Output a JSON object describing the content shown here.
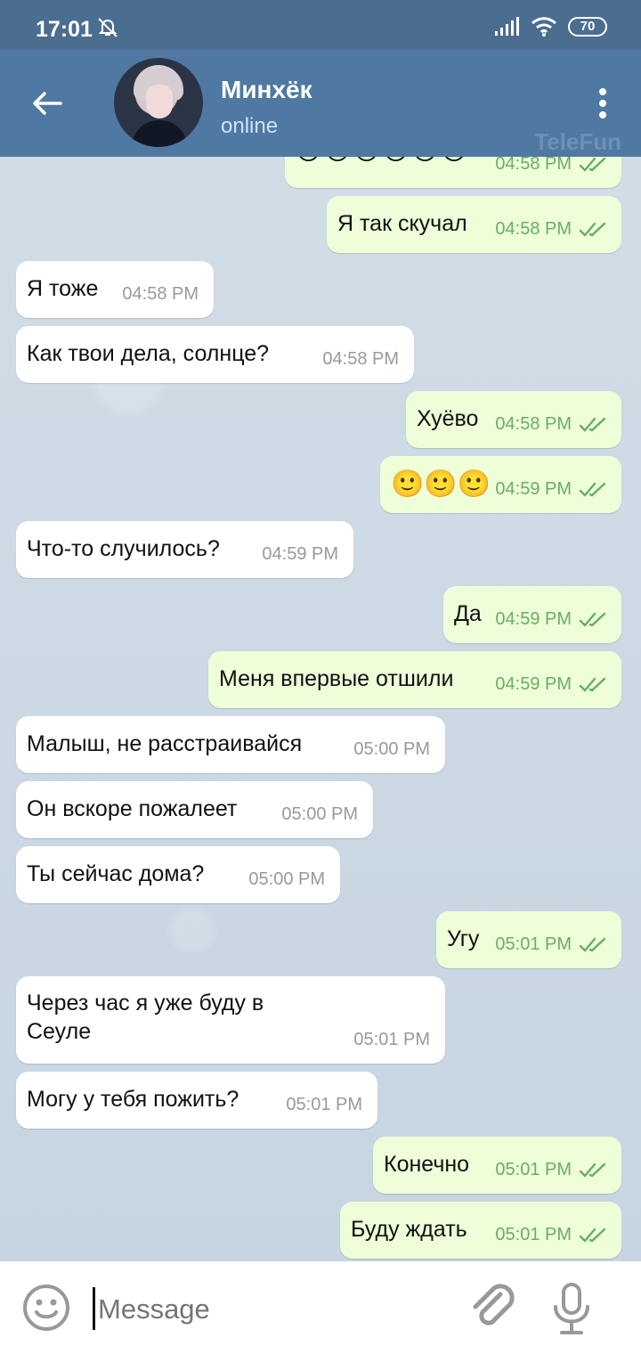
{
  "status_bar": {
    "time": "17:01",
    "battery": "70"
  },
  "header": {
    "name": "Минхёк",
    "status": "online",
    "watermark": "TeleFun"
  },
  "messages": [
    {
      "dir": "out",
      "text": "😭😭😭😭😭😭",
      "time": "04:58 PM"
    },
    {
      "dir": "out",
      "text": "Я так скучал",
      "time": "04:58 PM"
    },
    {
      "dir": "in",
      "text": "Я тоже",
      "time": "04:58 PM"
    },
    {
      "dir": "in",
      "text": "Как твои дела, солнце?",
      "time": "04:58 PM"
    },
    {
      "dir": "out",
      "text": "Хуёво",
      "time": "04:58 PM"
    },
    {
      "dir": "out",
      "text": "🙂🙂🙂",
      "time": "04:59 PM"
    },
    {
      "dir": "in",
      "text": "Что-то случилось?",
      "time": "04:59 PM"
    },
    {
      "dir": "out",
      "text": "Да",
      "time": "04:59 PM"
    },
    {
      "dir": "out",
      "text": "Меня впервые отшили",
      "time": "04:59 PM"
    },
    {
      "dir": "in",
      "text": "Малыш, не расстраивайся",
      "time": "05:00 PM"
    },
    {
      "dir": "in",
      "text": "Он вскоре пожалеет",
      "time": "05:00 PM"
    },
    {
      "dir": "in",
      "text": "Ты сейчас дома?",
      "time": "05:00 PM"
    },
    {
      "dir": "out",
      "text": "Угу",
      "time": "05:01 PM"
    },
    {
      "dir": "in",
      "text": "Через час я уже буду в Сеуле",
      "time": "05:01 PM"
    },
    {
      "dir": "in",
      "text": "Могу у тебя пожить?",
      "time": "05:01 PM"
    },
    {
      "dir": "out",
      "text": "Конечно",
      "time": "05:01 PM"
    },
    {
      "dir": "out",
      "text": "Буду ждать",
      "time": "05:01 PM"
    }
  ],
  "composer": {
    "placeholder": "Message"
  },
  "icons": {
    "back": "back-arrow-icon",
    "menu": "more-vertical-icon",
    "muted": "muted-bell-icon",
    "signal": "signal-icon",
    "wifi": "wifi-icon",
    "emoji": "emoji-icon",
    "attach": "paperclip-icon",
    "mic": "microphone-icon",
    "read": "double-check-icon"
  },
  "colors": {
    "header": "#4f79a3",
    "incoming": "#ffffff",
    "outgoing": "#eefed9",
    "read_check": "#6aad63"
  }
}
